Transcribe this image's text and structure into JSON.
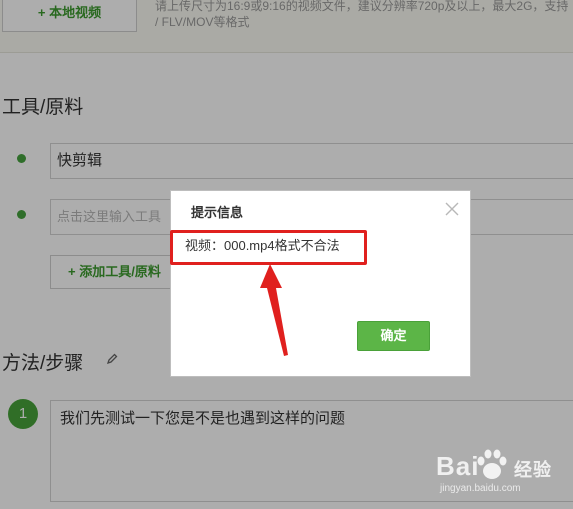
{
  "upload": {
    "local_video_label": "+ 本地视频",
    "hint_line1": "请上传尺寸为16:9或9:16的视频文件，建议分辨率720p及以上，最大2G，支持",
    "hint_line2": "/ FLV/MOV等格式"
  },
  "tools": {
    "title": "工具/原料",
    "field1_value": "快剪辑",
    "field2_placeholder": "点击这里输入工具",
    "add_label": "+ 添加工具/原料"
  },
  "steps": {
    "title": "方法/步骤",
    "items": [
      {
        "number": "1",
        "text": "我们先测试一下您是不是也遇到这样的问题"
      }
    ]
  },
  "dialog": {
    "title": "提示信息",
    "message": "视频：000.mp4格式不合法",
    "ok_label": "确定"
  },
  "watermark": {
    "brand_left": "Bai",
    "brand_right": "经验",
    "site": "jingyan.baidu.com"
  },
  "colors": {
    "accent_green": "#46a33e",
    "highlight_red": "#e0201e",
    "overlay": "rgba(0,0,0,0.32)"
  }
}
